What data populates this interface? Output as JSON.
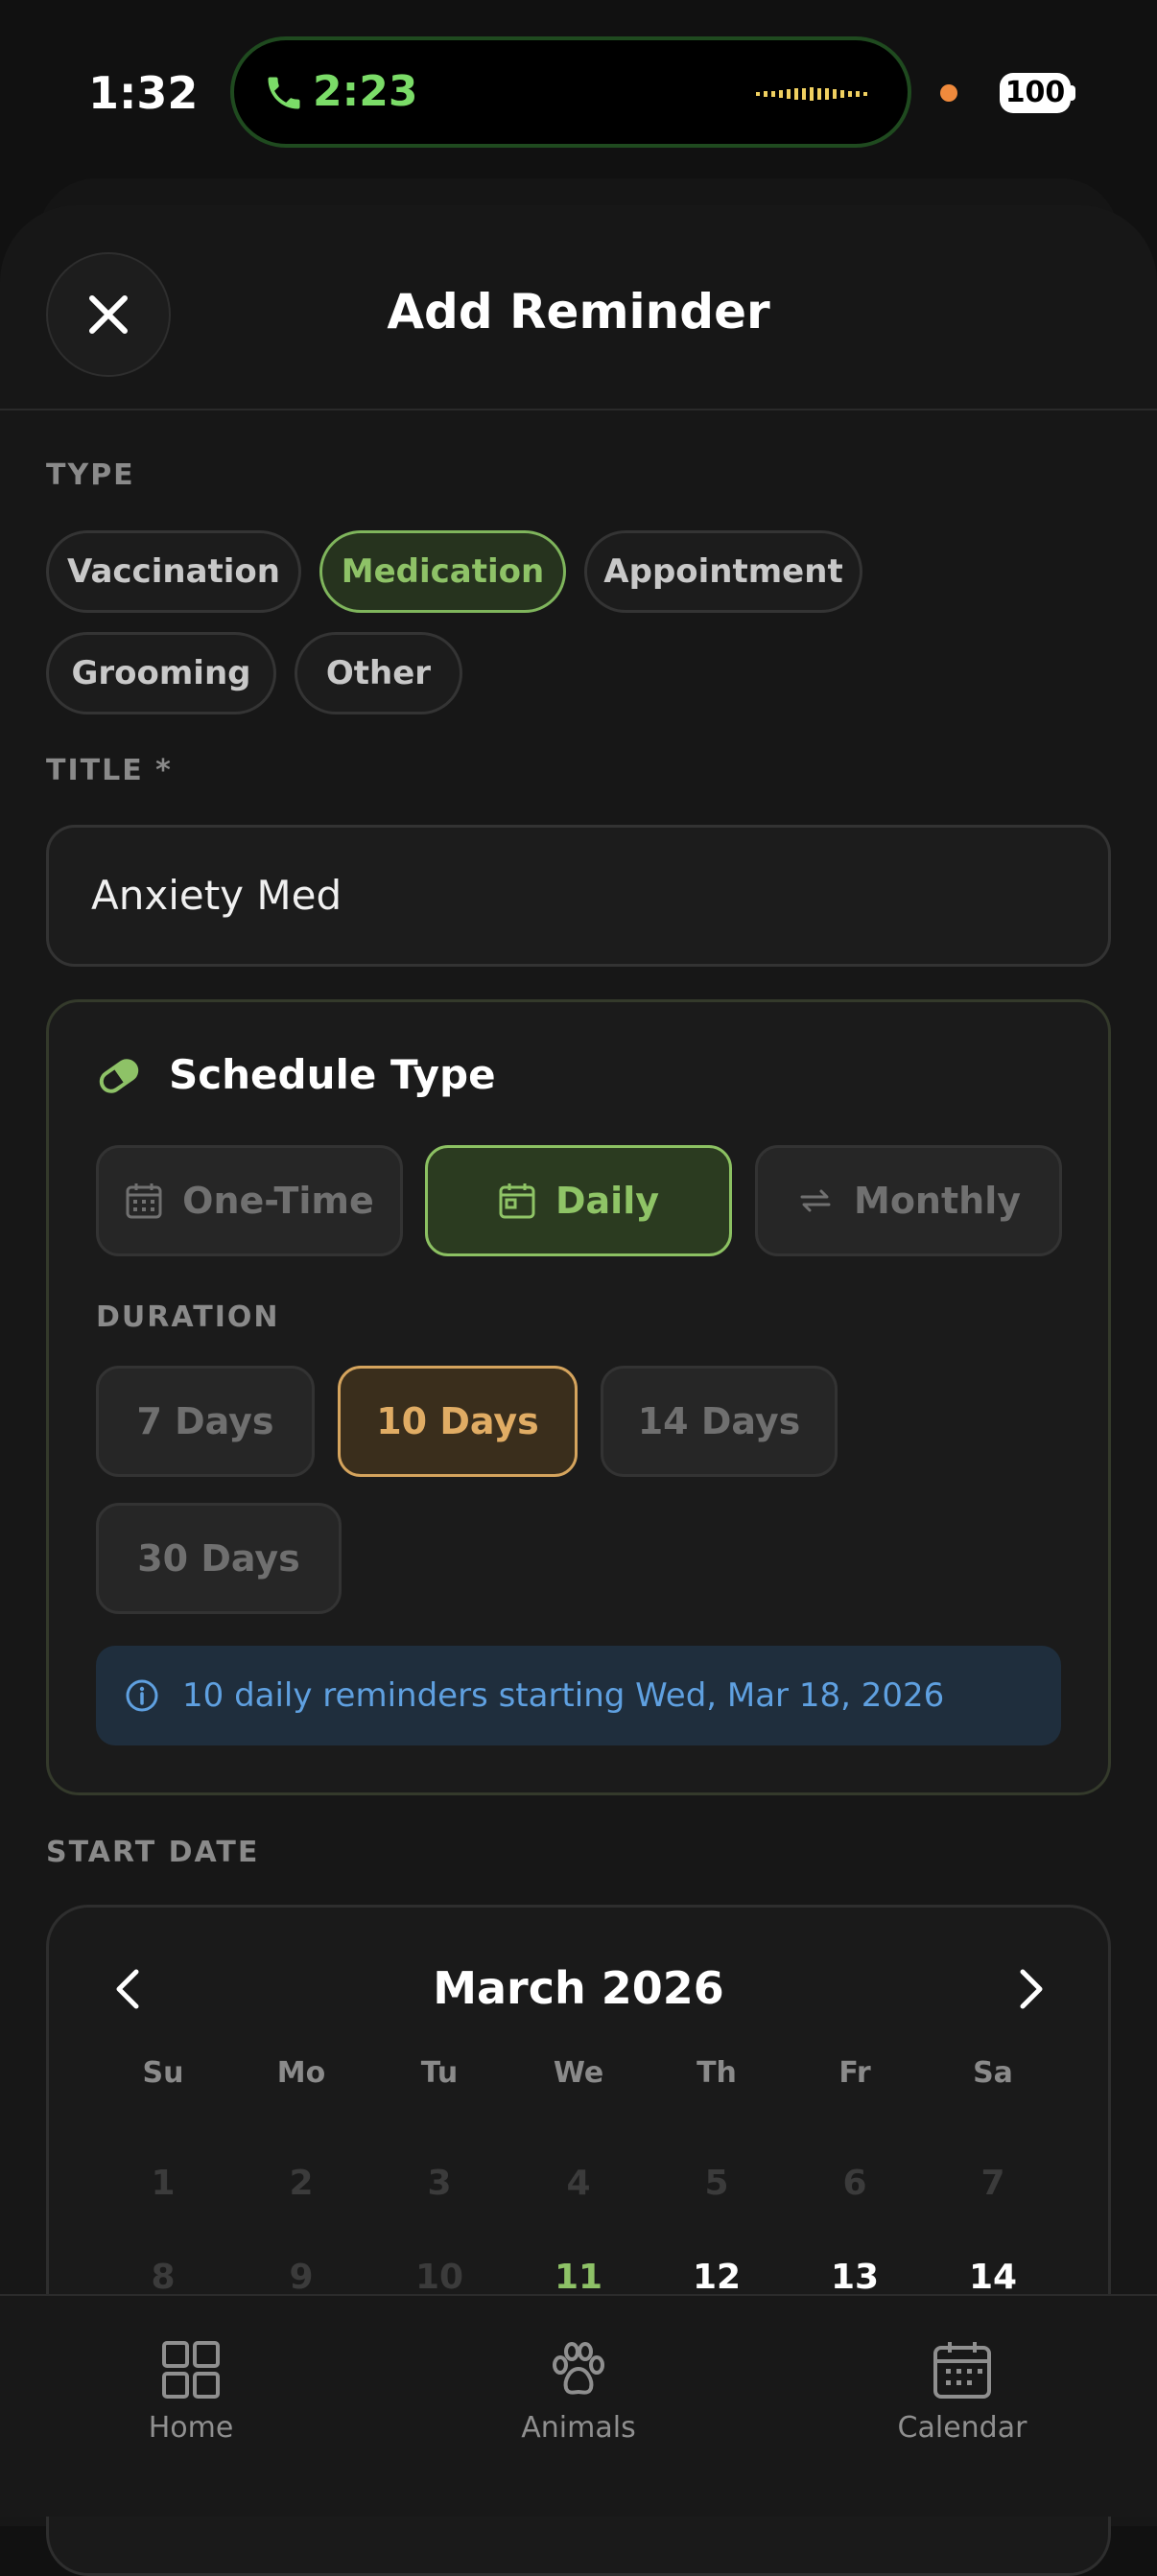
{
  "status": {
    "time": "1:32",
    "call_time": "2:23",
    "battery": "100"
  },
  "header": {
    "title": "Add Reminder"
  },
  "type_section": {
    "label": "TYPE",
    "options": [
      "Vaccination",
      "Medication",
      "Appointment",
      "Grooming",
      "Other"
    ],
    "selected": "Medication"
  },
  "title_field": {
    "label": "TITLE *",
    "value": "Anxiety Med"
  },
  "schedule": {
    "title": "Schedule Type",
    "options": [
      "One-Time",
      "Daily",
      "Monthly"
    ],
    "selected": "Daily",
    "duration_label": "DURATION",
    "durations": [
      "7 Days",
      "10 Days",
      "14 Days",
      "30 Days"
    ],
    "selected_duration": "10 Days",
    "info": "10 daily reminders starting Wed, Mar 18, 2026"
  },
  "start_date": {
    "label": "START DATE",
    "month": "March 2026",
    "weekdays": [
      "Su",
      "Mo",
      "Tu",
      "We",
      "Th",
      "Fr",
      "Sa"
    ],
    "row1": [
      "1",
      "2",
      "3",
      "4",
      "5",
      "6",
      "7"
    ],
    "row2": [
      "8",
      "9",
      "10",
      "11",
      "12",
      "13",
      "14"
    ]
  },
  "tabs": {
    "home": "Home",
    "animals": "Animals",
    "calendar": "Calendar"
  },
  "colors": {
    "accent_green": "#8ec267",
    "accent_amber": "#e0ac64",
    "info_blue": "#5fa0e0"
  }
}
